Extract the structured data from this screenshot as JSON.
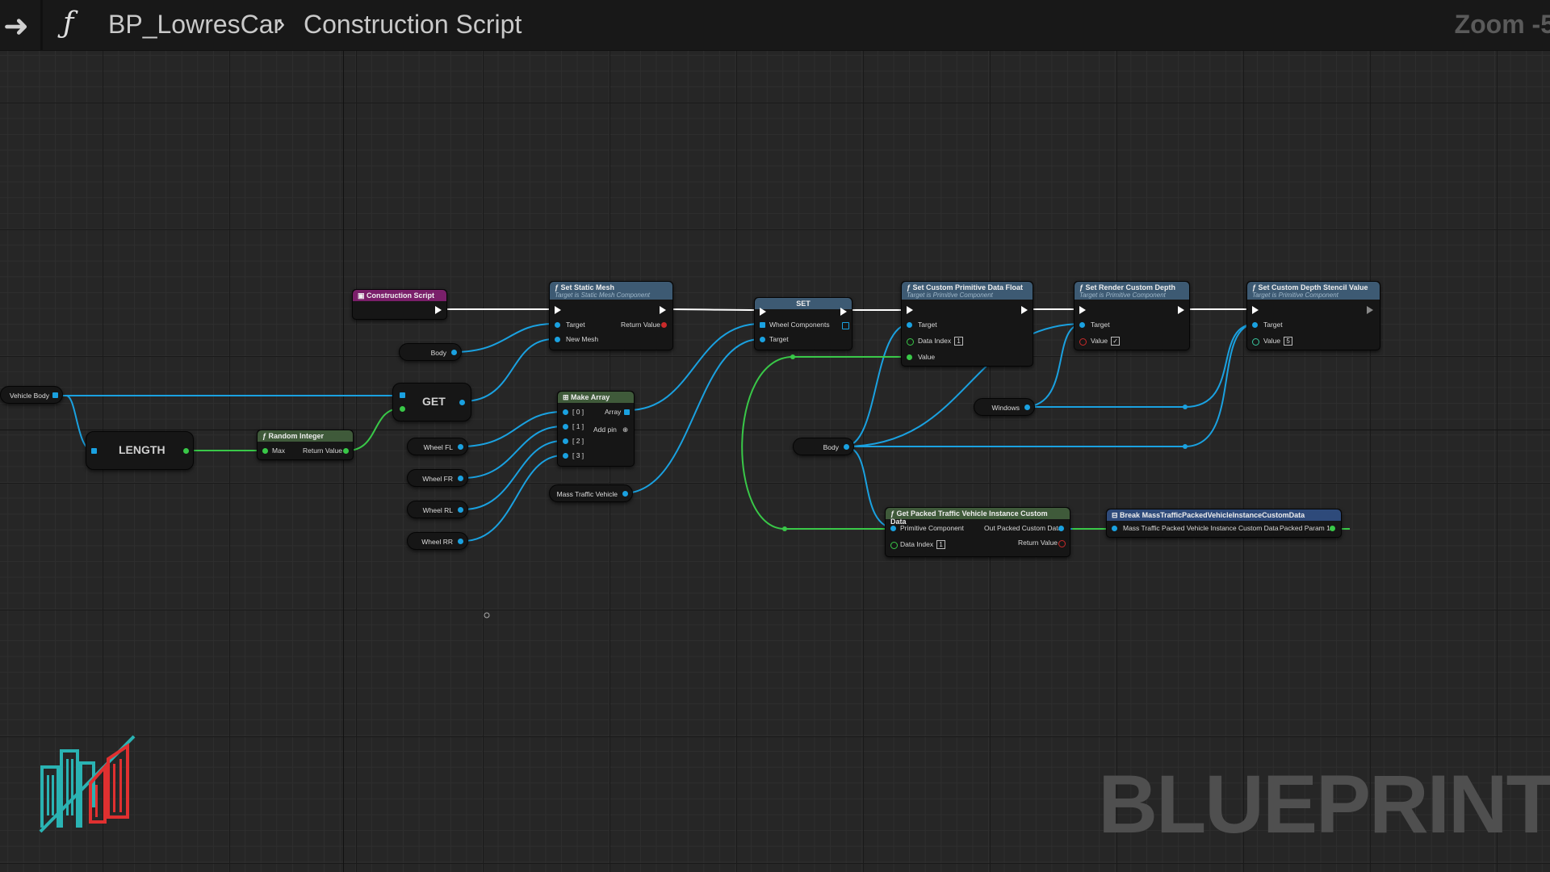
{
  "breadcrumb": {
    "blueprint": "BP_LowresCar",
    "graph": "Construction Script"
  },
  "zoom": "Zoom -5",
  "watermark": "BLUEPRINT",
  "nodes": {
    "construction_script": {
      "title": "Construction Script"
    },
    "set_static_mesh": {
      "title": "Set Static Mesh",
      "subtitle": "Target is Static Mesh Component",
      "target": "Target",
      "new_mesh": "New Mesh",
      "return_value": "Return Value"
    },
    "set_array": {
      "title": "SET",
      "wheel_components": "Wheel Components",
      "target": "Target"
    },
    "set_cpd_float": {
      "title": "Set Custom Primitive Data Float",
      "subtitle": "Target is Primitive Component",
      "target": "Target",
      "data_index": "Data Index",
      "data_index_value": "1",
      "value": "Value"
    },
    "set_render_custom_depth": {
      "title": "Set Render Custom Depth",
      "subtitle": "Target is Primitive Component",
      "target": "Target",
      "value": "Value",
      "value_checked": "✓"
    },
    "set_custom_depth_stencil": {
      "title": "Set Custom Depth Stencil Value",
      "subtitle": "Target is Primitive Component",
      "target": "Target",
      "value": "Value",
      "value_value": "5"
    },
    "make_array": {
      "title": "Make Array",
      "pins": [
        "[ 0 ]",
        "[ 1 ]",
        "[ 2 ]",
        "[ 3 ]"
      ],
      "array": "Array",
      "add_pin": "Add pin"
    },
    "get": {
      "title": "GET"
    },
    "length": {
      "title": "LENGTH"
    },
    "random_integer": {
      "title": "Random Integer",
      "max": "Max",
      "return_value": "Return Value"
    },
    "get_packed": {
      "title": "Get Packed Traffic Vehicle Instance Custom Data",
      "primitive_component": "Primitive Component",
      "out_packed": "Out Packed Custom Data",
      "data_index": "Data Index",
      "data_index_value": "1",
      "return_value": "Return Value"
    },
    "break_packed": {
      "title": "Break MassTrafficPackedVehicleInstanceCustomData",
      "input": "Mass Traffic Packed Vehicle Instance Custom Data",
      "output": "Packed Param 1"
    }
  },
  "variables": {
    "vehicle_body": "Vehicle Body",
    "body_top": "Body",
    "wheel_fl": "Wheel FL",
    "wheel_fr": "Wheel FR",
    "wheel_rl": "Wheel RL",
    "wheel_rr": "Wheel RR",
    "mass_traffic_vehicle": "Mass Traffic Vehicle",
    "windows": "Windows",
    "body_mid": "Body"
  },
  "colors": {
    "exec_wire": "#ffffff",
    "object_wire": "#1aa1e0",
    "int_wire": "#39c848",
    "function_header": "#3d5a73",
    "event_header": "#7a1f6a",
    "pure_header": "#3f5a3a"
  }
}
